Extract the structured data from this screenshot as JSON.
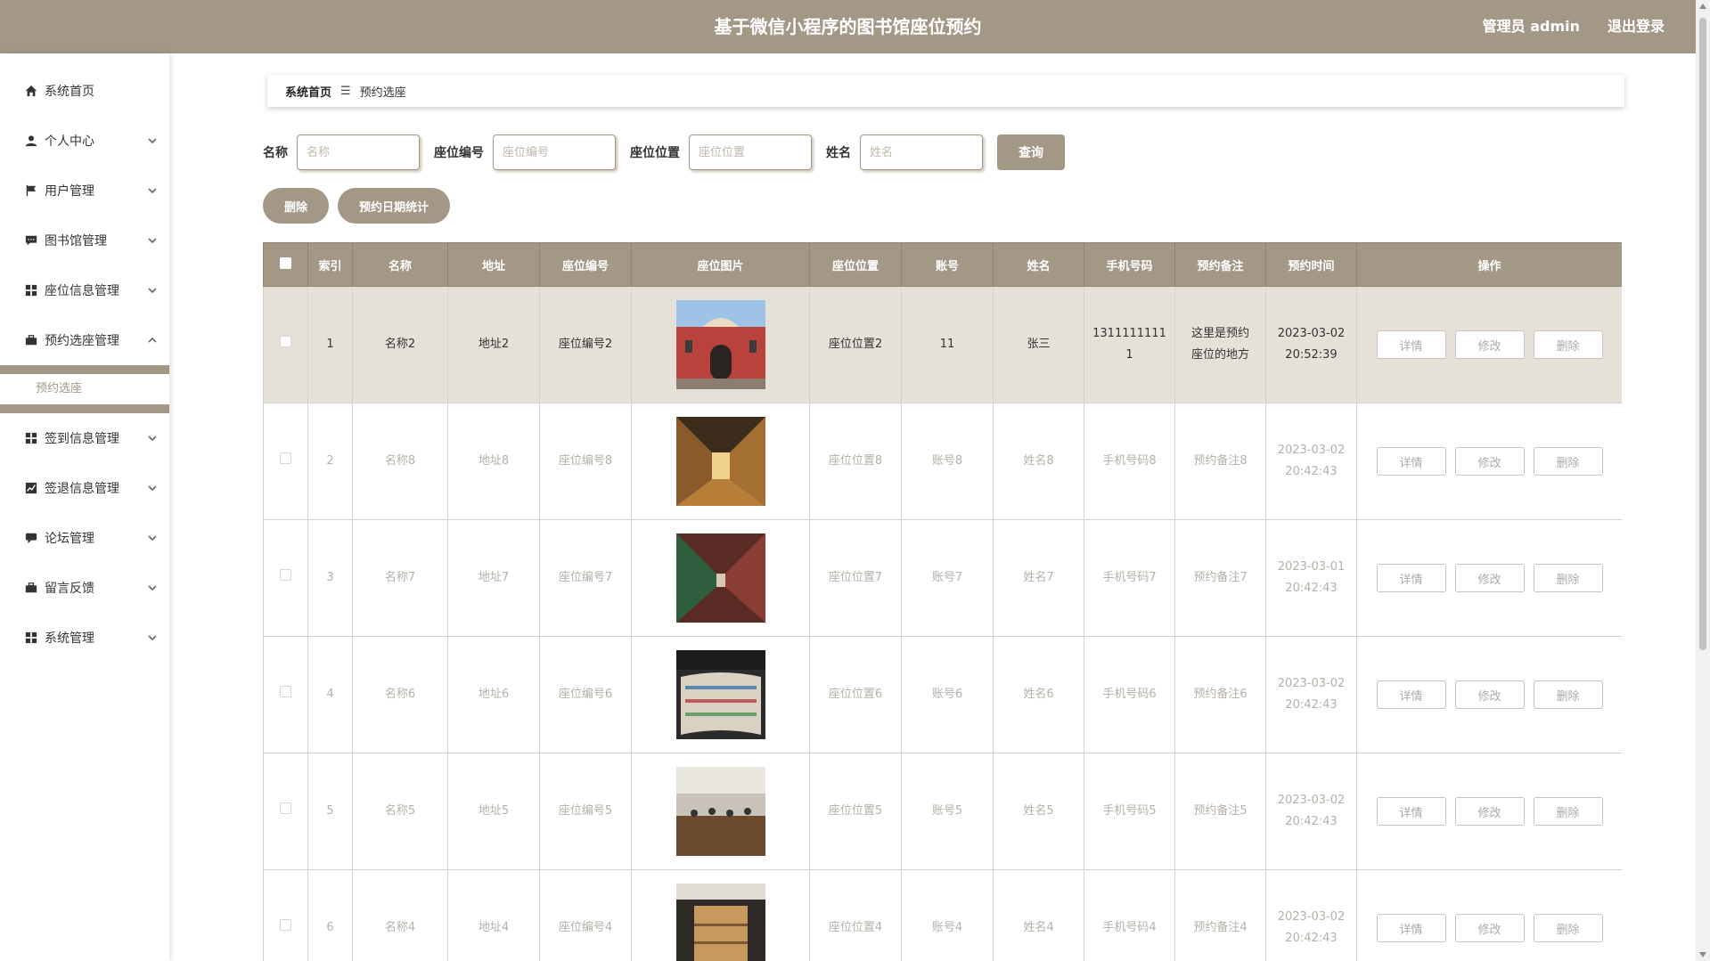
{
  "header": {
    "title": "基于微信小程序的图书馆座位预约",
    "admin": "管理员 admin",
    "logout": "退出登录"
  },
  "sidebar": {
    "items": [
      {
        "label": "系统首页",
        "icon": "home-icon"
      },
      {
        "label": "个人中心",
        "icon": "user-icon"
      },
      {
        "label": "用户管理",
        "icon": "flag-icon"
      },
      {
        "label": "图书馆管理",
        "icon": "comment-icon"
      },
      {
        "label": "座位信息管理",
        "icon": "grid-icon"
      },
      {
        "label": "预约选座管理",
        "icon": "briefcase-icon"
      },
      {
        "label": "签到信息管理",
        "icon": "grid-icon"
      },
      {
        "label": "签退信息管理",
        "icon": "chart-icon"
      },
      {
        "label": "论坛管理",
        "icon": "chat-icon"
      },
      {
        "label": "留言反馈",
        "icon": "briefcase-icon"
      },
      {
        "label": "系统管理",
        "icon": "grid-icon"
      }
    ],
    "submenu": "预约选座"
  },
  "breadcrumb": {
    "home": "系统首页",
    "sep": "☰",
    "current": "预约选座"
  },
  "search": {
    "name_label": "名称",
    "name_placeholder": "名称",
    "seat_no_label": "座位编号",
    "seat_no_placeholder": "座位编号",
    "seat_pos_label": "座位位置",
    "seat_pos_placeholder": "座位位置",
    "person_label": "姓名",
    "person_placeholder": "姓名",
    "query_button": "查询"
  },
  "actions": {
    "delete": "删除",
    "stats": "预约日期统计"
  },
  "table": {
    "headers": [
      "索引",
      "名称",
      "地址",
      "座位编号",
      "座位图片",
      "座位位置",
      "账号",
      "姓名",
      "手机号码",
      "预约备注",
      "预约时间",
      "操作"
    ],
    "op_labels": {
      "detail": "详情",
      "edit": "修改",
      "delete": "删除"
    },
    "rows": [
      {
        "index": "1",
        "name": "名称2",
        "address": "地址2",
        "seat_no": "座位编号2",
        "image": "library-exterior",
        "seat_pos": "座位位置2",
        "account": "11",
        "person": "张三",
        "phone_a": "1311111111",
        "phone_b": "1",
        "note_a": "这里是预约",
        "note_b": "座位的地方",
        "date": "2023-03-02",
        "time": "20:52:39"
      },
      {
        "index": "2",
        "name": "名称8",
        "address": "地址8",
        "seat_no": "座位编号8",
        "image": "bookshelf-aisle",
        "seat_pos": "座位位置8",
        "account": "账号8",
        "person": "姓名8",
        "phone_a": "手机号码8",
        "phone_b": "",
        "note_a": "预约备注8",
        "note_b": "",
        "date": "2023-03-02",
        "time": "20:42:43"
      },
      {
        "index": "3",
        "name": "名称7",
        "address": "地址7",
        "seat_no": "座位编号7",
        "image": "bookshelf-red",
        "seat_pos": "座位位置7",
        "account": "账号7",
        "person": "姓名7",
        "phone_a": "手机号码7",
        "phone_b": "",
        "note_a": "预约备注7",
        "note_b": "",
        "date": "2023-03-01",
        "time": "20:42:43"
      },
      {
        "index": "4",
        "name": "名称6",
        "address": "地址6",
        "seat_no": "座位编号6",
        "image": "bookshelf-round",
        "seat_pos": "座位位置6",
        "account": "账号6",
        "person": "姓名6",
        "phone_a": "手机号码6",
        "phone_b": "",
        "note_a": "预约备注6",
        "note_b": "",
        "date": "2023-03-02",
        "time": "20:42:43"
      },
      {
        "index": "5",
        "name": "名称5",
        "address": "地址5",
        "seat_no": "座位编号5",
        "image": "reading-hall",
        "seat_pos": "座位位置5",
        "account": "账号5",
        "person": "姓名5",
        "phone_a": "手机号码5",
        "phone_b": "",
        "note_a": "预约备注5",
        "note_b": "",
        "date": "2023-03-02",
        "time": "20:42:43"
      },
      {
        "index": "6",
        "name": "名称4",
        "address": "地址4",
        "seat_no": "座位编号4",
        "image": "bookshelf-wood",
        "seat_pos": "座位位置4",
        "account": "账号4",
        "person": "姓名4",
        "phone_a": "手机号码4",
        "phone_b": "",
        "note_a": "预约备注4",
        "note_b": "",
        "date": "2023-03-02",
        "time": "20:42:43"
      }
    ]
  },
  "colors": {
    "accent": "#a39885",
    "selected_row": "#e5e1d9"
  }
}
